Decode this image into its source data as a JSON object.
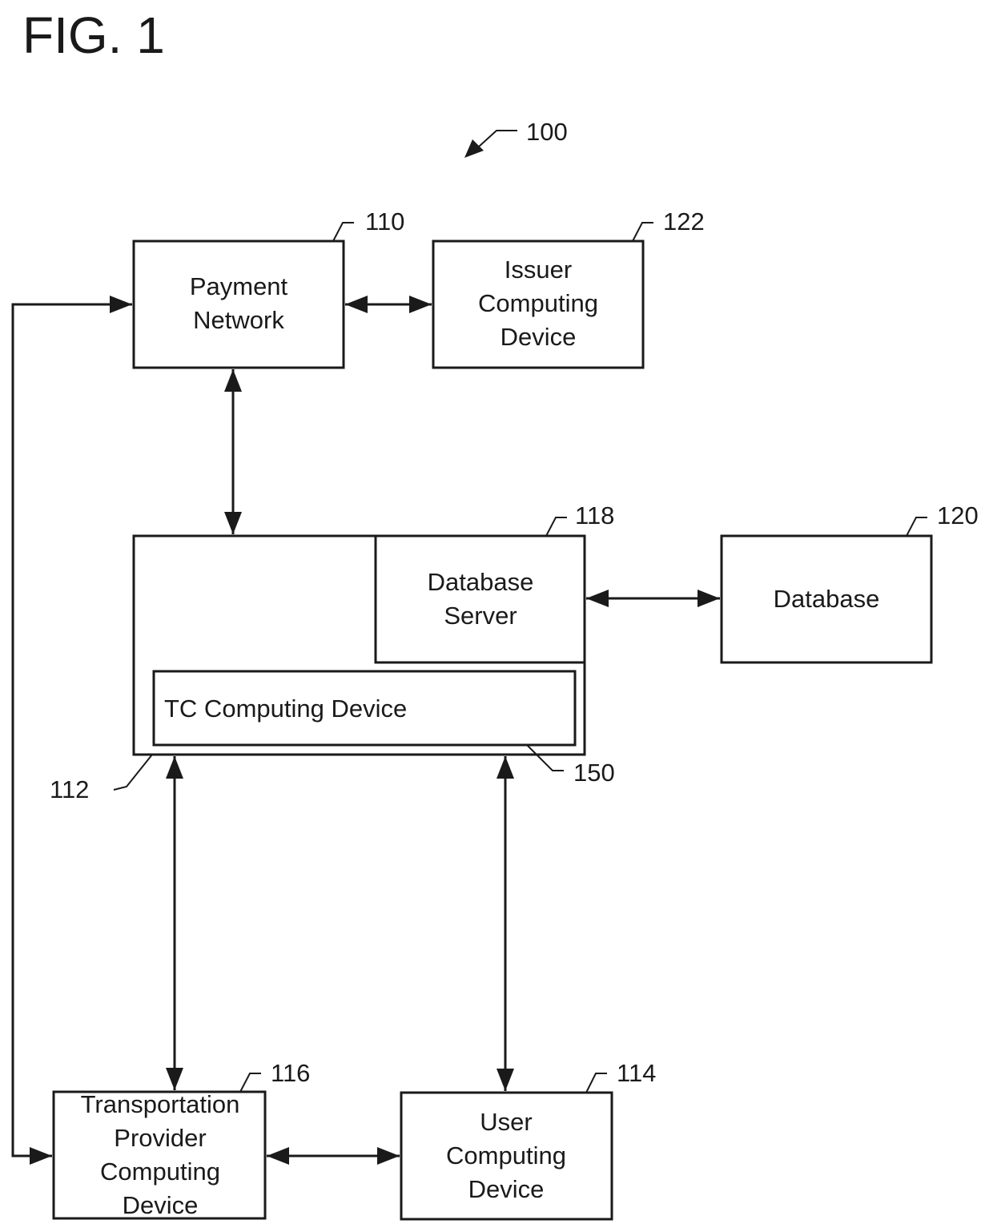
{
  "figure": {
    "title": "FIG. 1",
    "system_ref": "100"
  },
  "nodes": {
    "payment_network": {
      "ref": "110",
      "lines": [
        "Payment",
        "Network"
      ]
    },
    "issuer": {
      "ref": "122",
      "lines": [
        "Issuer",
        "Computing",
        "Device"
      ]
    },
    "tc_system": {
      "ref": "112"
    },
    "database_server": {
      "ref": "118",
      "lines": [
        "Database",
        "Server"
      ]
    },
    "tc_device": {
      "ref": "150",
      "label": "TC Computing Device"
    },
    "database": {
      "ref": "120",
      "lines": [
        "Database"
      ]
    },
    "transport_provider": {
      "ref": "116",
      "lines": [
        "Transportation",
        "Provider",
        "Computing",
        "Device"
      ]
    },
    "user_device": {
      "ref": "114",
      "lines": [
        "User",
        "Computing",
        "Device"
      ]
    }
  },
  "edges": [
    {
      "from": "payment_network",
      "to": "issuer",
      "direction": "bidirectional"
    },
    {
      "from": "payment_network",
      "to": "tc_system",
      "direction": "bidirectional"
    },
    {
      "from": "database_server",
      "to": "database",
      "direction": "bidirectional"
    },
    {
      "from": "tc_system",
      "to": "transport_provider",
      "direction": "bidirectional"
    },
    {
      "from": "tc_system",
      "to": "user_device",
      "direction": "bidirectional"
    },
    {
      "from": "transport_provider",
      "to": "user_device",
      "direction": "bidirectional"
    },
    {
      "from": "payment_network",
      "to": "transport_provider",
      "direction": "bidirectional"
    }
  ]
}
